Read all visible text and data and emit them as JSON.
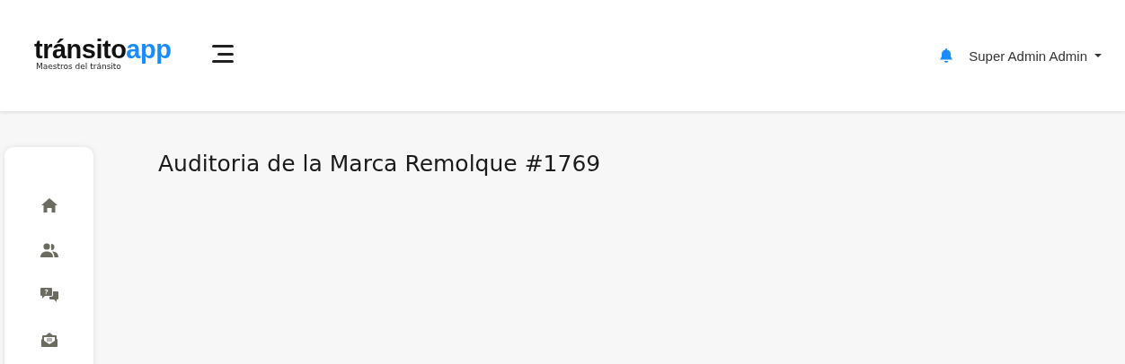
{
  "logo": {
    "name": "tránsito",
    "name_accent": "app",
    "tagline": "Maestros del tránsito"
  },
  "user_menu": {
    "label": "Super Admin Admin",
    "notifications": true
  },
  "sidebar": {
    "items": [
      {
        "kind": "home"
      },
      {
        "kind": "users"
      },
      {
        "kind": "questions"
      },
      {
        "kind": "mail"
      }
    ]
  },
  "page": {
    "title": "Auditoria de la Marca Remolque #1769"
  }
}
